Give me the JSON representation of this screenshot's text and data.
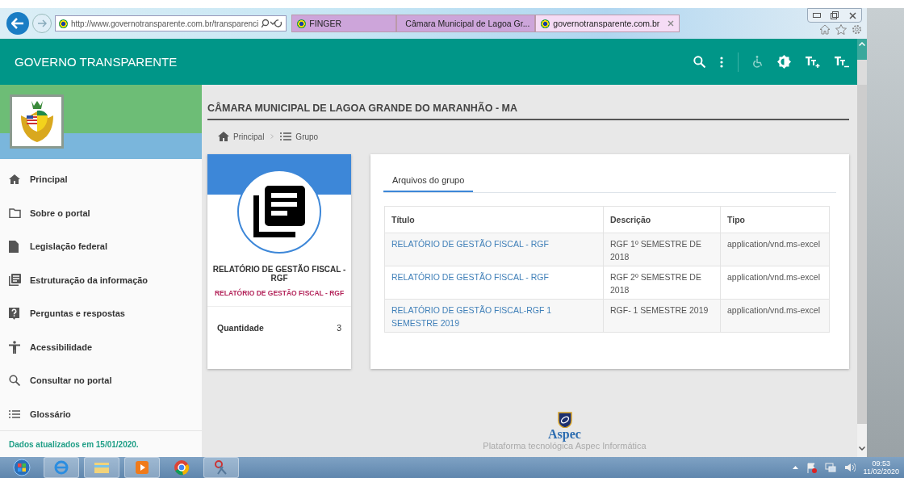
{
  "browser": {
    "url": "http://www.governotransparente.com.br/transparenci",
    "tabs": [
      {
        "label": "FINGER",
        "selected": false
      },
      {
        "label": "Câmara Municipal de Lagoa Gr...",
        "selected": false
      },
      {
        "label": "governotransparente.com.br",
        "selected": true
      }
    ]
  },
  "header": {
    "title": "GOVERNO TRANSPARENTE"
  },
  "sidebar": {
    "items": [
      {
        "label": "Principal",
        "kind": "home"
      },
      {
        "label": "Sobre o portal",
        "kind": "folder"
      },
      {
        "label": "Legislação federal",
        "kind": "file"
      },
      {
        "label": "Estruturação da informação",
        "kind": "library"
      },
      {
        "label": "Perguntas e respostas",
        "kind": "help"
      },
      {
        "label": "Acessibilidade",
        "kind": "person"
      },
      {
        "label": "Consultar no portal",
        "kind": "search"
      },
      {
        "label": "Glossário",
        "kind": "list"
      }
    ],
    "updated": "Dados atualizados em 15/01/2020."
  },
  "page": {
    "title": "CÂMARA MUNICIPAL DE LAGOA GRANDE DO MARANHÃO - MA",
    "breadcrumb": [
      {
        "label": "Principal",
        "kind": "home"
      },
      {
        "label": "Grupo",
        "kind": "list"
      }
    ],
    "group": {
      "title": "RELATÓRIO DE GESTÃO FISCAL - RGF",
      "subtitle": "RELATÓRIO DE GESTÃO FISCAL - RGF",
      "count_label": "Quantidade",
      "count": "3"
    },
    "files": {
      "tabs": [
        {
          "label": "Arquivos do grupo",
          "selected": true
        }
      ],
      "columns": [
        "Título",
        "Descrição",
        "Tipo"
      ],
      "rows": [
        [
          "RELATÓRIO DE GESTÃO FISCAL - RGF",
          "RGF 1º SEMESTRE DE 2018",
          "application/vnd.ms-excel"
        ],
        [
          "RELATÓRIO DE GESTÃO FISCAL - RGF",
          "RGF 2º SEMESTRE DE 2018",
          "application/vnd.ms-excel"
        ],
        [
          "RELATÓRIO DE GESTÃO FISCAL-RGF 1 SEMESTRE 2019",
          "RGF- 1 SEMESTRE 2019",
          "application/vnd.ms-excel"
        ]
      ]
    }
  },
  "footer": {
    "brand": "Aspec",
    "tagline": "Plataforma tecnológica Aspec Informática"
  },
  "taskbar": {
    "time": "09:53",
    "date": "11/02/2020"
  }
}
